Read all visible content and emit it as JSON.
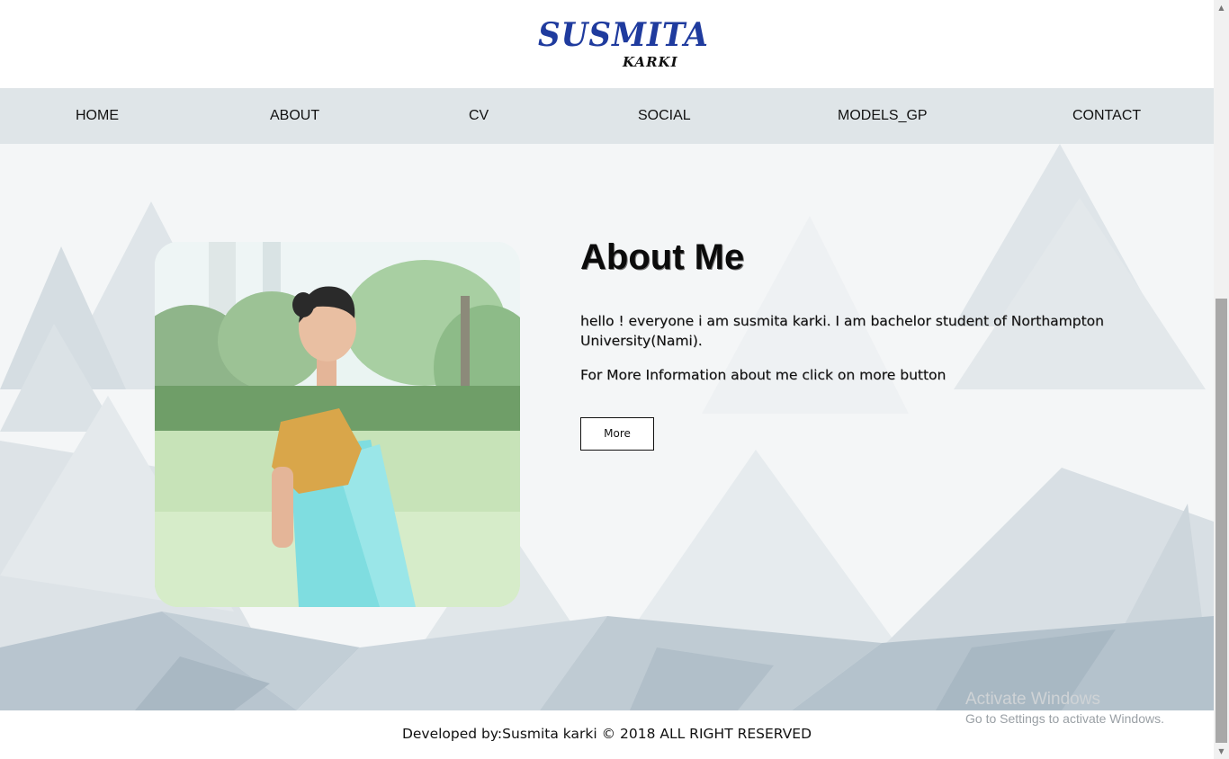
{
  "logo": {
    "main": "SUSMITA",
    "sub": "KARKI"
  },
  "nav": {
    "items": [
      {
        "label": "HOME"
      },
      {
        "label": "ABOUT"
      },
      {
        "label": "CV"
      },
      {
        "label": "SOCIAL"
      },
      {
        "label": "MODELS_GP"
      },
      {
        "label": "CONTACT"
      }
    ]
  },
  "about": {
    "title": "About Me",
    "paragraph1": "hello ! everyone i am susmita karki. I am bachelor student of Northampton University(Nami).",
    "paragraph2": "For More Information about me click on more button",
    "more_label": "More"
  },
  "footer": {
    "text": "Developed by:Susmita karki © 2018 ALL RIGHT RESERVED"
  },
  "watermark": {
    "title": "Activate Windows",
    "subtitle": "Go to Settings to activate Windows."
  },
  "colors": {
    "logo_blue": "#1f3b9e",
    "nav_bg": "#dfe5e8",
    "hero_bg": "#eef1f3",
    "dress": "#7fdde0",
    "blouse": "#d9a64a"
  },
  "icons": {
    "scroll_up": "scroll-up-arrow-icon",
    "scroll_down": "scroll-down-arrow-icon"
  }
}
